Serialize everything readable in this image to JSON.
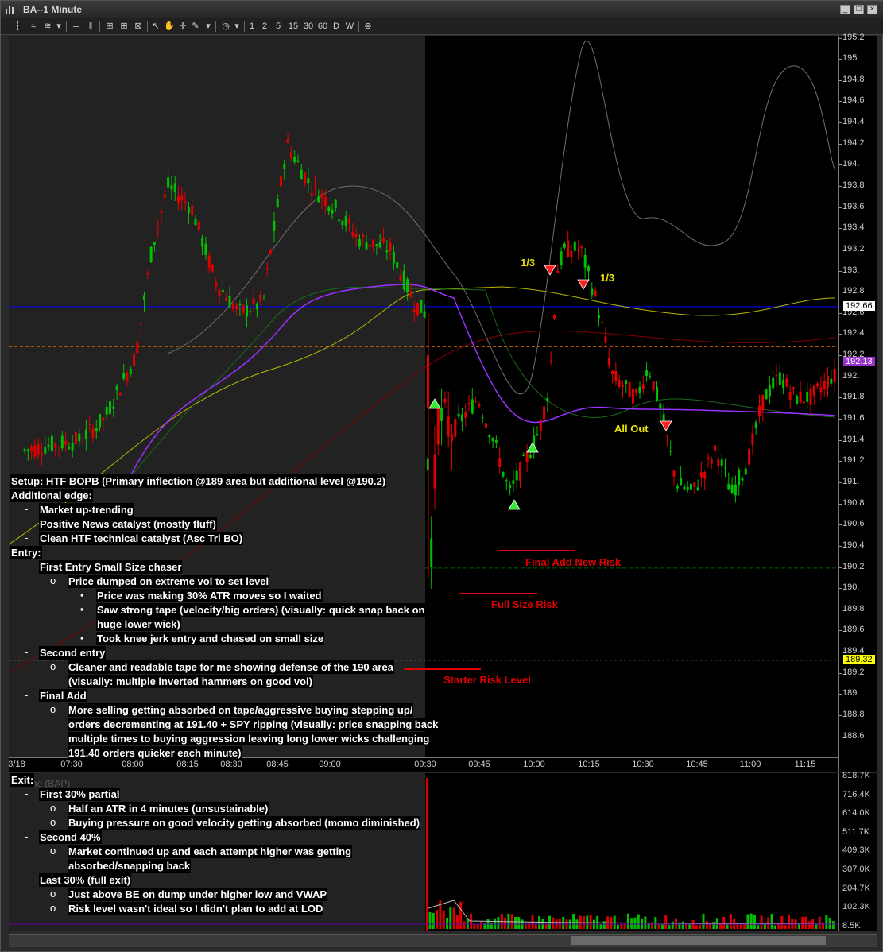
{
  "window": {
    "title": "BA--1 Minute",
    "controls": [
      "_",
      "□",
      "×"
    ]
  },
  "toolbar": {
    "icon_names": [
      "bars-icon",
      "line-icon",
      "dropdown-icon",
      "lines-icon",
      "lines2-icon",
      "grid-icon",
      "grid2-icon",
      "grid3-icon",
      "pointer-icon",
      "hand-icon",
      "crosshair-icon",
      "pencil-icon",
      "dropdown-icon",
      "clock-icon",
      "dropdown-icon"
    ],
    "intervals": [
      "1",
      "2",
      "5",
      "15",
      "30",
      "60",
      "D",
      "W"
    ],
    "close_symbol": "⊗"
  },
  "chart": {
    "colors": {
      "up": "#00c000",
      "down": "#e00000",
      "vwap": "#8a2be2",
      "blue_line": "#0000ff",
      "orange_line": "#aa5500",
      "red_ma": "#800000",
      "yellow_ma": "#b8b800",
      "gray_line": "#707070",
      "green_ma": "#006400",
      "accent_yellow": "#e8e000",
      "accent_red": "#e00000"
    },
    "y_labels": [
      "195.2",
      "195.",
      "194.8",
      "194.6",
      "194.4",
      "194.2",
      "194.",
      "193.8",
      "193.6",
      "193.4",
      "193.2",
      "193.",
      "192.8",
      "192.6",
      "192.4",
      "192.2",
      "192.",
      "191.8",
      "191.6",
      "191.4",
      "191.2",
      "191.",
      "190.8",
      "190.6",
      "190.4",
      "190.2",
      "190.",
      "189.8",
      "189.6",
      "189.4",
      "189.2",
      "189.",
      "188.8",
      "188.6"
    ],
    "y_values": [
      195.2,
      195.0,
      194.8,
      194.6,
      194.4,
      194.2,
      194.0,
      193.8,
      193.6,
      193.4,
      193.2,
      193.0,
      192.8,
      192.6,
      192.4,
      192.2,
      192.0,
      191.8,
      191.6,
      191.4,
      191.2,
      191.0,
      190.8,
      190.6,
      190.4,
      190.2,
      190.0,
      189.8,
      189.6,
      189.4,
      189.2,
      189.0,
      188.8,
      188.6
    ],
    "x_labels": [
      "3/18",
      "07:30",
      "08:00",
      "08:15",
      "08:30",
      "08:45",
      "09:00",
      "09:30",
      "09:45",
      "10:00",
      "10:15",
      "10:30",
      "10:45",
      "11:00",
      "11:15"
    ],
    "price_tags": [
      {
        "label": "192.66",
        "value": 192.66,
        "bg": "#ffffff",
        "fg": "#000000"
      },
      {
        "label": "192.13",
        "value": 192.13,
        "bg": "#9932cc",
        "fg": "#ffffff"
      },
      {
        "label": "189.32",
        "value": 189.32,
        "bg": "#ffff00",
        "fg": "#000000"
      }
    ],
    "volume_labels": [
      "818.7K",
      "716.4K",
      "614.0K",
      "511.7K",
      "409.3K",
      "307.0K",
      "204.7K",
      "102.3K",
      "8.5K"
    ],
    "volume_title": "Volume (BAP)"
  },
  "annotations": {
    "third1": "1/3",
    "third2": "1/3",
    "all_out": "All Out",
    "final_add": "Final Add New Risk",
    "full_size": "Full Size Risk",
    "starter": "Starter Risk Level"
  },
  "notes": {
    "setup": "Setup: HTF BOPB (Primary inflection @189 area but additional level @190.2)",
    "edge_title": "Additional edge:",
    "edge1": "Market up-trending",
    "edge2": "Positive News catalyst (mostly fluff)",
    "edge3": "Clean HTF technical catalyst (Asc Tri BO)",
    "entry_title": "Entry:",
    "e1": "First Entry Small Size chaser",
    "e1a": "Price dumped on extreme vol to set level",
    "e1a1": "Price was making 30% ATR moves so I waited",
    "e1a2a": "Saw strong tape (velocity/big orders) (visually: quick snap back on",
    "e1a2b": "huge lower wick)",
    "e1a3": "Took knee jerk entry and chased on small size",
    "e2": "Second entry",
    "e2a_a": "Cleaner and readable tape for me showing defense of the 190 area",
    "e2a_b": "(visually: multiple inverted hammers on good vol)",
    "e3": "Final Add",
    "e3a_a": "More selling getting absorbed on tape/aggressive buying stepping up/",
    "e3a_b": "orders decrementing at 191.40 + SPY ripping (visually: price snapping back",
    "e3a_c": "multiple times to buying aggression leaving long lower wicks challenging",
    "e3a_d": "191.40 orders quicker each minute)",
    "exit_title": "Exit:",
    "x1": "First 30% partial",
    "x1a": "Half an ATR in 4 minutes (unsustainable)",
    "x1b": "Buying pressure on good velocity getting absorbed (momo diminished)",
    "x2": "Second 40%",
    "x2a_a": "Market continued up and each attempt higher was getting",
    "x2a_b": "absorbed/snapping back",
    "x3": "Last 30% (full exit)",
    "x3a": "Just above BE on dump under higher low and VWAP",
    "x3b": "Risk level wasn't ideal so I didn't plan to add at LOD"
  }
}
